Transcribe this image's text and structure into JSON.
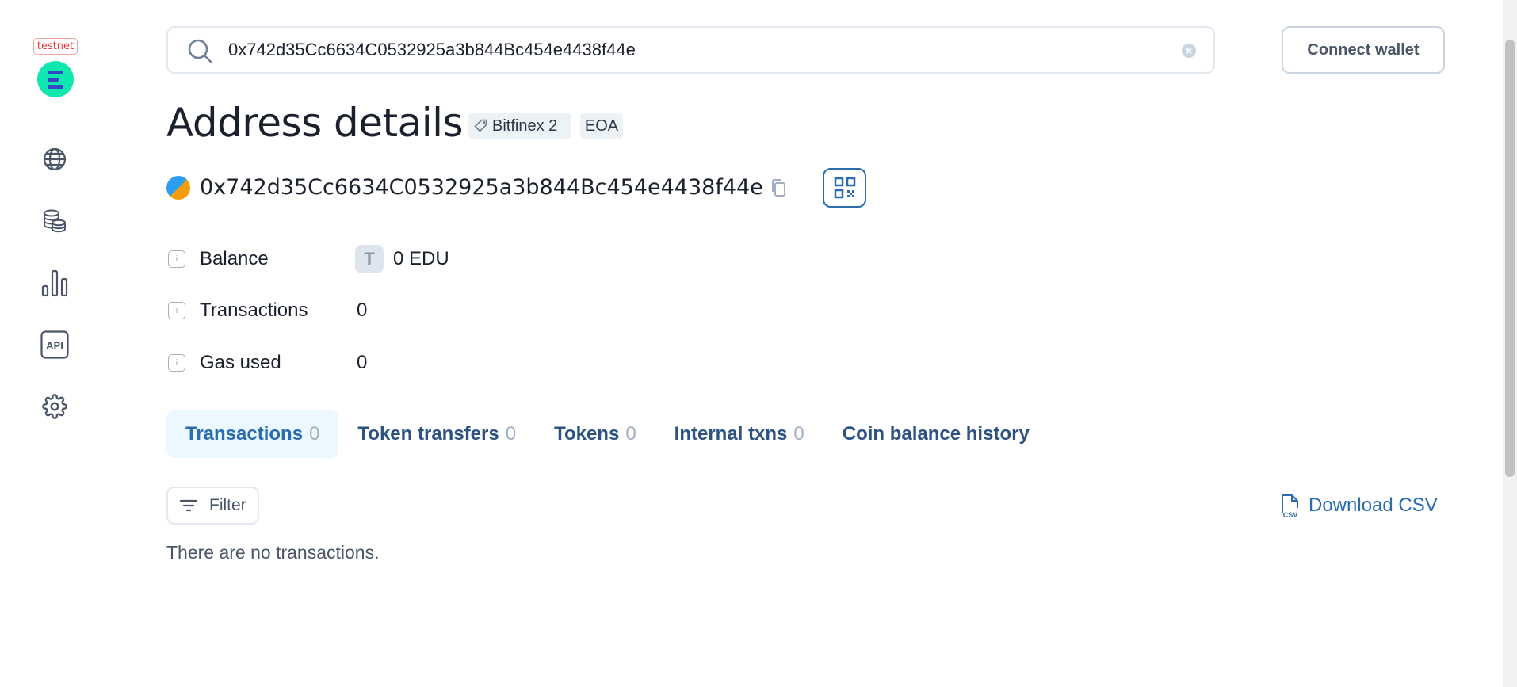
{
  "sidebar": {
    "network_badge": "testnet",
    "items": [
      {
        "icon": "globe-icon"
      },
      {
        "icon": "coins-icon"
      },
      {
        "icon": "stats-icon"
      },
      {
        "icon": "api-icon",
        "label": "API"
      },
      {
        "icon": "gear-icon"
      }
    ]
  },
  "search": {
    "value": "0x742d35Cc6634C0532925a3b844Bc454e4438f44e"
  },
  "header": {
    "connect_wallet_label": "Connect wallet"
  },
  "page": {
    "title": "Address details",
    "tags": [
      "Bitfinex 2",
      "EOA"
    ],
    "address": "0x742d35Cc6634C0532925a3b844Bc454e4438f44e"
  },
  "details": {
    "balance_label": "Balance",
    "balance_token_letter": "T",
    "balance_value": "0 EDU",
    "transactions_label": "Transactions",
    "transactions_value": "0",
    "gas_label": "Gas used",
    "gas_value": "0"
  },
  "tabs": [
    {
      "label": "Transactions",
      "count": "0",
      "active": true
    },
    {
      "label": "Token transfers",
      "count": "0"
    },
    {
      "label": "Tokens",
      "count": "0"
    },
    {
      "label": "Internal txns",
      "count": "0"
    },
    {
      "label": "Coin balance history",
      "count": ""
    }
  ],
  "toolbar": {
    "filter_label": "Filter",
    "download_label": "Download CSV",
    "csv_icon_text": "CSV"
  },
  "empty_state": "There are no transactions.",
  "colors": {
    "accent": "#2b6cb0",
    "logo": "#10e6b0",
    "testnet": "#e53e3e"
  }
}
